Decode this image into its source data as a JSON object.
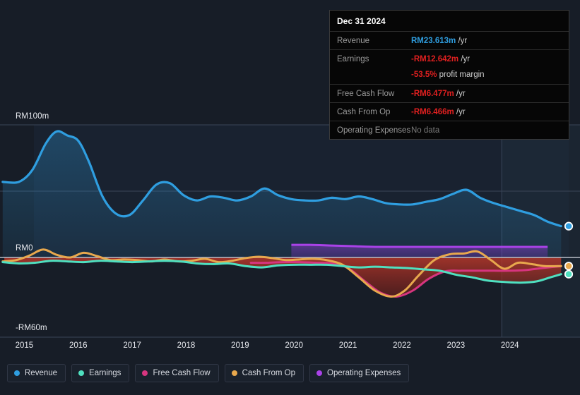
{
  "axes": {
    "y_top_label": "RM100m",
    "y_zero_label": "RM0",
    "y_bottom_label": "-RM60m",
    "x_ticks": [
      "2015",
      "2016",
      "2017",
      "2018",
      "2019",
      "2020",
      "2021",
      "2022",
      "2023",
      "2024"
    ]
  },
  "tooltip": {
    "date": "Dec 31 2024",
    "rows": [
      {
        "label": "Revenue",
        "amount": "RM23.613m",
        "unit": "/yr",
        "color": "#2f9ee0"
      },
      {
        "label": "Earnings",
        "amount": "-RM12.642m",
        "unit": "/yr",
        "color": "#e02020"
      },
      {
        "label": "",
        "amount": "-53.5%",
        "unit": "profit margin",
        "color": "#e02020",
        "sub": true
      },
      {
        "label": "Free Cash Flow",
        "amount": "-RM6.477m",
        "unit": "/yr",
        "color": "#e02020"
      },
      {
        "label": "Cash From Op",
        "amount": "-RM6.466m",
        "unit": "/yr",
        "color": "#e02020"
      },
      {
        "label": "Operating Expenses",
        "amount": "No data",
        "unit": "",
        "color": "#7a7a7a"
      }
    ]
  },
  "legend": {
    "items": [
      {
        "label": "Revenue",
        "color": "#2f9ee0"
      },
      {
        "label": "Earnings",
        "color": "#4fe0c0"
      },
      {
        "label": "Free Cash Flow",
        "color": "#d6357f"
      },
      {
        "label": "Cash From Op",
        "color": "#e8a84d"
      },
      {
        "label": "Operating Expenses",
        "color": "#a942e8"
      }
    ]
  },
  "chart_data": {
    "type": "area",
    "title": "",
    "xlabel": "",
    "ylabel": "",
    "currency": "MYR (RM), millions",
    "ylim": [
      -60,
      100
    ],
    "xlim": [
      2014.55,
      2025.3
    ],
    "grid": true,
    "legend_position": "bottom-left",
    "gridlines_y": [
      100,
      50,
      0,
      -60
    ],
    "forecast_start": 2023.85,
    "annotations": [
      "Dec 31 2024 tooltip at top-right",
      "end-point markers on Revenue, Cash From Op, Earnings"
    ],
    "series": [
      {
        "name": "Revenue",
        "color": "#2f9ee0",
        "fill": "rgba(47,158,224,0.16)",
        "x": [
          2014.6,
          2014.9,
          2015.15,
          2015.4,
          2015.6,
          2015.8,
          2016.0,
          2016.2,
          2016.45,
          2016.7,
          2016.95,
          2017.2,
          2017.45,
          2017.7,
          2017.95,
          2018.2,
          2018.45,
          2018.7,
          2018.95,
          2019.2,
          2019.45,
          2019.7,
          2019.95,
          2020.2,
          2020.45,
          2020.7,
          2020.95,
          2021.2,
          2021.45,
          2021.7,
          2021.95,
          2022.2,
          2022.45,
          2022.7,
          2022.95,
          2023.2,
          2023.45,
          2023.7,
          2023.95,
          2024.2,
          2024.45,
          2024.7,
          2024.95
        ],
        "y": [
          57,
          57,
          66,
          86,
          95,
          92,
          88,
          72,
          46,
          33,
          32,
          43,
          55,
          56,
          47,
          43,
          46,
          45,
          43,
          46,
          52,
          47,
          44,
          43,
          43,
          45,
          44,
          46,
          44,
          41,
          40,
          40,
          42,
          44,
          48,
          51,
          45,
          41,
          38,
          35,
          32,
          27,
          23.6
        ]
      },
      {
        "name": "Earnings",
        "color": "#4fe0c0",
        "fill": "rgba(79,224,192,0.10)",
        "x": [
          2014.6,
          2014.9,
          2015.2,
          2015.5,
          2015.8,
          2016.1,
          2016.4,
          2016.7,
          2017.0,
          2017.3,
          2017.6,
          2017.9,
          2018.2,
          2018.5,
          2018.8,
          2019.1,
          2019.4,
          2019.7,
          2020.0,
          2020.3,
          2020.6,
          2020.9,
          2021.2,
          2021.5,
          2021.8,
          2022.1,
          2022.4,
          2022.7,
          2023.0,
          2023.3,
          2023.6,
          2023.9,
          2024.2,
          2024.5,
          2024.75,
          2024.95
        ],
        "y": [
          -3.5,
          -4.5,
          -4.0,
          -2.5,
          -3.0,
          -3.5,
          -2.5,
          -3.0,
          -3.5,
          -3.0,
          -2.5,
          -3.0,
          -4.5,
          -5.0,
          -4.5,
          -6.5,
          -7.5,
          -6.0,
          -5.5,
          -5.5,
          -5.5,
          -6.5,
          -7.5,
          -7.0,
          -7.5,
          -8.0,
          -9.0,
          -10.0,
          -13.0,
          -15.0,
          -17.5,
          -18.5,
          -19.0,
          -18.0,
          -15.0,
          -12.6
        ]
      },
      {
        "name": "Free Cash Flow",
        "color": "#d6357f",
        "fill": "rgba(214,53,127,0.10)",
        "x": [
          2019.2,
          2019.5,
          2019.8,
          2020.1,
          2020.4,
          2020.7,
          2021.0,
          2021.3,
          2021.6,
          2021.9,
          2022.2,
          2022.5,
          2022.8,
          2023.1,
          2023.4,
          2023.7,
          2024.0,
          2024.3,
          2024.6,
          2024.95
        ],
        "y": [
          -4.0,
          -4.0,
          -3.5,
          -3.5,
          -4.0,
          -4.5,
          -8.0,
          -17.5,
          -26.5,
          -29.5,
          -25.0,
          -16.0,
          -10.5,
          -10.0,
          -10.0,
          -10.0,
          -10.0,
          -9.5,
          -8.0,
          -6.5
        ]
      },
      {
        "name": "Cash From Op",
        "color": "#e8a84d",
        "fill": "rgba(232,168,77,0.14)",
        "x": [
          2014.6,
          2014.85,
          2015.1,
          2015.35,
          2015.6,
          2015.85,
          2016.1,
          2016.35,
          2016.6,
          2016.85,
          2017.1,
          2017.35,
          2017.6,
          2017.85,
          2018.1,
          2018.35,
          2018.6,
          2018.85,
          2019.1,
          2019.35,
          2019.6,
          2019.85,
          2020.1,
          2020.35,
          2020.6,
          2020.9,
          2021.2,
          2021.5,
          2021.8,
          2022.05,
          2022.3,
          2022.6,
          2022.9,
          2023.15,
          2023.4,
          2023.65,
          2023.9,
          2024.15,
          2024.4,
          2024.65,
          2024.95
        ],
        "y": [
          -3.0,
          -2.0,
          1.5,
          6.0,
          2.0,
          0.0,
          3.5,
          1.0,
          -2.0,
          -1.5,
          -2.0,
          -3.0,
          -1.5,
          -3.0,
          -2.5,
          -1.0,
          -3.5,
          -2.5,
          -0.5,
          0.5,
          -0.5,
          -2.0,
          -1.5,
          -1.0,
          -2.0,
          -5.5,
          -15.0,
          -25.0,
          -29.5,
          -25.0,
          -14.0,
          -2.0,
          2.5,
          3.0,
          4.5,
          -2.0,
          -8.5,
          -4.0,
          -5.0,
          -6.5,
          -6.5
        ]
      },
      {
        "name": "Operating Expenses",
        "color": "#a942e8",
        "fill": "rgba(169,66,232,0.22)",
        "x": [
          2019.95,
          2020.3,
          2020.7,
          2021.1,
          2021.5,
          2021.9,
          2022.3,
          2022.7,
          2023.1,
          2023.5,
          2023.9,
          2024.3,
          2024.7
        ],
        "y": [
          9.5,
          9.5,
          9.0,
          8.5,
          8.0,
          8.0,
          8.0,
          8.0,
          8.0,
          8.0,
          8.0,
          8.0,
          8.0
        ]
      }
    ]
  }
}
